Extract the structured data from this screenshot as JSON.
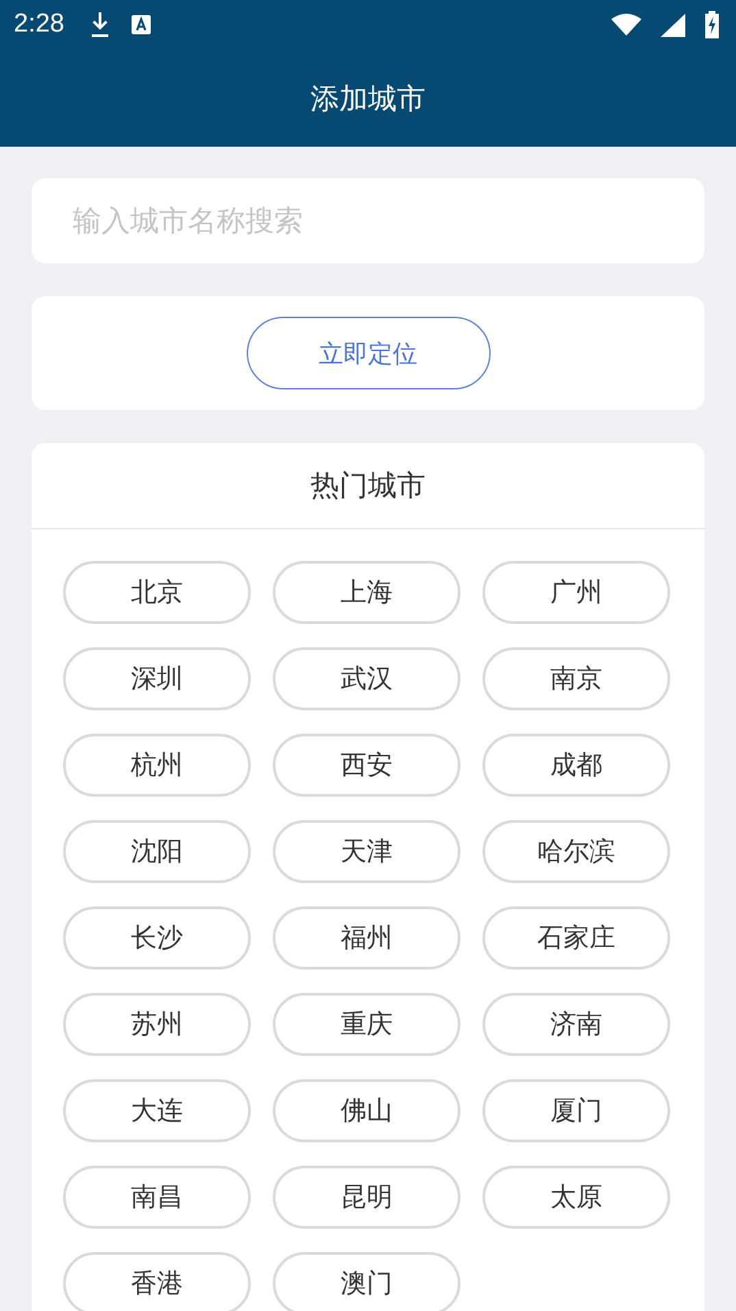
{
  "status_bar": {
    "time": "2:28"
  },
  "header": {
    "title": "添加城市"
  },
  "search": {
    "placeholder": "输入城市名称搜索"
  },
  "locate_button": {
    "label": "立即定位"
  },
  "hot_cities": {
    "title": "热门城市",
    "cities": [
      "北京",
      "上海",
      "广州",
      "深圳",
      "武汉",
      "南京",
      "杭州",
      "西安",
      "成都",
      "沈阳",
      "天津",
      "哈尔滨",
      "长沙",
      "福州",
      "石家庄",
      "苏州",
      "重庆",
      "济南",
      "大连",
      "佛山",
      "厦门",
      "南昌",
      "昆明",
      "太原",
      "香港",
      "澳门"
    ]
  }
}
